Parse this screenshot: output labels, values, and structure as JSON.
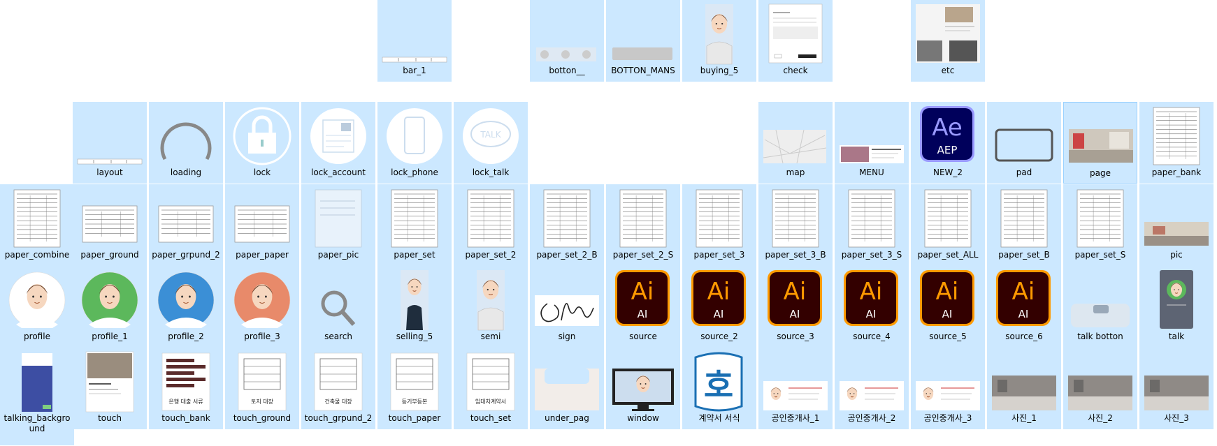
{
  "window": {
    "view": "Large icons"
  },
  "colors": {
    "tile": "#cce8ff",
    "ai_bg": "#330000",
    "ai_fg": "#ff9a00",
    "ae_bg": "#00005b",
    "ae_fg": "#9999ff"
  },
  "items": [
    {
      "name": "bar_1",
      "kind": "bar",
      "col": 5,
      "row": 0
    },
    {
      "name": "botton__",
      "kind": "buttons",
      "col": 7,
      "row": 0
    },
    {
      "name": "BOTTON_MANS",
      "kind": "graybar",
      "col": 8,
      "row": 0
    },
    {
      "name": "buying_5",
      "kind": "person",
      "col": 9,
      "row": 0
    },
    {
      "name": "check",
      "kind": "form",
      "col": 10,
      "row": 0
    },
    {
      "name": "etc",
      "kind": "photos",
      "col": 12,
      "row": 0
    },
    {
      "name": "layout",
      "kind": "bar",
      "col": 1,
      "row": 1
    },
    {
      "name": "loading",
      "kind": "arc",
      "col": 2,
      "row": 1
    },
    {
      "name": "lock",
      "kind": "lock",
      "col": 3,
      "row": 1
    },
    {
      "name": "lock_account",
      "kind": "circle-doc",
      "col": 4,
      "row": 1
    },
    {
      "name": "lock_phone",
      "kind": "circle-phone",
      "col": 5,
      "row": 1
    },
    {
      "name": "lock_talk",
      "kind": "circle-talk",
      "col": 6,
      "row": 1
    },
    {
      "name": "map",
      "kind": "map",
      "col": 10,
      "row": 1
    },
    {
      "name": "MENU",
      "kind": "menu",
      "col": 11,
      "row": 1
    },
    {
      "name": "NEW_2",
      "kind": "ae",
      "col": 12,
      "row": 1
    },
    {
      "name": "pad",
      "kind": "pad",
      "col": 13,
      "row": 1
    },
    {
      "name": "page",
      "kind": "room",
      "col": 14,
      "row": 1,
      "selected": true
    },
    {
      "name": "paper_bank",
      "kind": "doc",
      "col": 15,
      "row": 1
    },
    {
      "name": "paper_combine",
      "kind": "doc",
      "col": 0,
      "row": 2
    },
    {
      "name": "paper_ground",
      "kind": "doc-wide",
      "col": 1,
      "row": 2
    },
    {
      "name": "paper_grpund_2",
      "kind": "doc-wide",
      "col": 2,
      "row": 2
    },
    {
      "name": "paper_paper",
      "kind": "doc-wide",
      "col": 3,
      "row": 2
    },
    {
      "name": "paper_pic",
      "kind": "doc-blank",
      "col": 4,
      "row": 2
    },
    {
      "name": "paper_set",
      "kind": "doc",
      "col": 5,
      "row": 2
    },
    {
      "name": "paper_set_2",
      "kind": "doc",
      "col": 6,
      "row": 2
    },
    {
      "name": "paper_set_2_B",
      "kind": "doc",
      "col": 7,
      "row": 2
    },
    {
      "name": "paper_set_2_S",
      "kind": "doc",
      "col": 8,
      "row": 2
    },
    {
      "name": "paper_set_3",
      "kind": "doc",
      "col": 9,
      "row": 2
    },
    {
      "name": "paper_set_3_B",
      "kind": "doc",
      "col": 10,
      "row": 2
    },
    {
      "name": "paper_set_3_S",
      "kind": "doc",
      "col": 11,
      "row": 2
    },
    {
      "name": "paper_set_ALL",
      "kind": "doc",
      "col": 12,
      "row": 2
    },
    {
      "name": "paper_set_B",
      "kind": "doc",
      "col": 13,
      "row": 2
    },
    {
      "name": "paper_set_S",
      "kind": "doc",
      "col": 14,
      "row": 2
    },
    {
      "name": "pic",
      "kind": "room-small",
      "col": 15,
      "row": 2
    },
    {
      "name": "profile",
      "kind": "avatar",
      "col": 0,
      "row": 3,
      "bg": "#ffffff"
    },
    {
      "name": "profile_1",
      "kind": "avatar",
      "col": 1,
      "row": 3,
      "bg": "#5cb85c"
    },
    {
      "name": "profile_2",
      "kind": "avatar",
      "col": 2,
      "row": 3,
      "bg": "#3b8fd6"
    },
    {
      "name": "profile_3",
      "kind": "avatar",
      "col": 3,
      "row": 3,
      "bg": "#e88a6a"
    },
    {
      "name": "search",
      "kind": "search",
      "col": 4,
      "row": 3
    },
    {
      "name": "selling_5",
      "kind": "woman",
      "col": 5,
      "row": 3
    },
    {
      "name": "semi",
      "kind": "person",
      "col": 6,
      "row": 3
    },
    {
      "name": "sign",
      "kind": "sign",
      "col": 7,
      "row": 3
    },
    {
      "name": "source",
      "kind": "ai",
      "col": 8,
      "row": 3
    },
    {
      "name": "source_2",
      "kind": "ai",
      "col": 9,
      "row": 3
    },
    {
      "name": "source_3",
      "kind": "ai",
      "col": 10,
      "row": 3
    },
    {
      "name": "source_4",
      "kind": "ai",
      "col": 11,
      "row": 3
    },
    {
      "name": "source_5",
      "kind": "ai",
      "col": 12,
      "row": 3
    },
    {
      "name": "source_6",
      "kind": "ai",
      "col": 13,
      "row": 3
    },
    {
      "name": "talk botton",
      "kind": "talkbtn",
      "col": 14,
      "row": 3
    },
    {
      "name": "talk",
      "kind": "talkphone",
      "col": 15,
      "row": 3
    },
    {
      "name": "talking_background",
      "kind": "phone-blue",
      "col": 0,
      "row": 4,
      "wrap": true
    },
    {
      "name": "touch",
      "kind": "listing",
      "col": 1,
      "row": 4
    },
    {
      "name": "touch_bank",
      "kind": "card-bank",
      "col": 2,
      "row": 4,
      "caption": "은행 대출 서류"
    },
    {
      "name": "touch_ground",
      "kind": "card",
      "col": 3,
      "row": 4,
      "caption": "토지 대장"
    },
    {
      "name": "touch_grpund_2",
      "kind": "card",
      "col": 4,
      "row": 4,
      "caption": "건축물 대장"
    },
    {
      "name": "touch_paper",
      "kind": "card",
      "col": 5,
      "row": 4,
      "caption": "등기부등본"
    },
    {
      "name": "touch_set",
      "kind": "card",
      "col": 6,
      "row": 4,
      "caption": "임대차계약서"
    },
    {
      "name": "under_pag",
      "kind": "underpag",
      "col": 7,
      "row": 4
    },
    {
      "name": "window",
      "kind": "monitor",
      "col": 8,
      "row": 4
    },
    {
      "name": "계약서 서식",
      "kind": "hangul",
      "col": 9,
      "row": 4,
      "glyph": "호"
    },
    {
      "name": "공인중개사_1",
      "kind": "bizcard",
      "col": 10,
      "row": 4
    },
    {
      "name": "공인중개사_2",
      "kind": "bizcard",
      "col": 11,
      "row": 4
    },
    {
      "name": "공인중개사_3",
      "kind": "bizcard",
      "col": 12,
      "row": 4
    },
    {
      "name": "사진_1",
      "kind": "kitchen",
      "col": 13,
      "row": 4
    },
    {
      "name": "사진_2",
      "kind": "kitchen",
      "col": 14,
      "row": 4
    },
    {
      "name": "사진_3",
      "kind": "kitchen",
      "col": 15,
      "row": 4
    }
  ]
}
